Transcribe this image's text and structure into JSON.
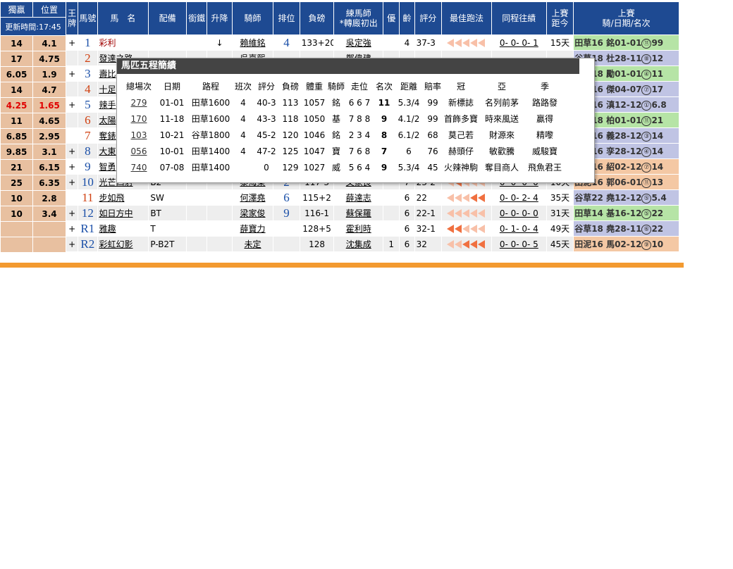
{
  "odds": {
    "win_label": "獨贏",
    "place_label": "位置",
    "update_label": "更新時間:17:45",
    "rows": [
      {
        "win": "14",
        "place": "4.1"
      },
      {
        "win": "17",
        "place": "4.75"
      },
      {
        "win": "6.05",
        "place": "1.9"
      },
      {
        "win": "14",
        "place": "4.7"
      },
      {
        "win": "4.25",
        "place": "1.65",
        "red": true
      },
      {
        "win": "11",
        "place": "4.65"
      },
      {
        "win": "6.85",
        "place": "2.95"
      },
      {
        "win": "9.85",
        "place": "3.1"
      },
      {
        "win": "21",
        "place": "6.15"
      },
      {
        "win": "25",
        "place": "6.35"
      },
      {
        "win": "10",
        "place": "2.8"
      },
      {
        "win": "10",
        "place": "3.4"
      },
      {
        "win": "",
        "place": ""
      },
      {
        "win": "",
        "place": ""
      }
    ]
  },
  "headers": [
    "王牌",
    "馬號",
    "馬　名",
    "配備",
    "銜鐵",
    "升降",
    "騎師",
    "排位",
    "負磅",
    "練馬師\n*轉廄初出",
    "優",
    "齡",
    "評分",
    "最佳跑法",
    "同程往績",
    "上賽\n距今",
    "上賽\n騎/日期/名次"
  ],
  "rows": [
    {
      "ace": "+",
      "no": "1",
      "name": "彩利",
      "gear": "",
      "bit": "",
      "change": "↓",
      "jockey": "賴維銘",
      "draw": "4",
      "wt": "133+20",
      "trainer": "吳定強",
      "pref": "",
      "age": "4",
      "rating": "37-3",
      "style": "hhhhh",
      "same": "0- 0- 0- 1",
      "days": "15天",
      "last": "田草16 銘01-01",
      "pos": "⑪",
      "tail": "99",
      "lc": "green"
    },
    {
      "ace": "",
      "no": "2",
      "name": "發達之路",
      "gear": "",
      "bit": "",
      "change": "",
      "jockey": "吳嘉熙",
      "draw": "",
      "wt": "",
      "trainer": "鄭偉建",
      "pref": "",
      "age": "",
      "rating": "",
      "style": "",
      "same": "",
      "days": "",
      "last": "谷草18 杜28-11",
      "pos": "⑧",
      "tail": "12",
      "lc": "blue"
    },
    {
      "ace": "+",
      "no": "3",
      "name": "壽比",
      "gear": "",
      "bit": "",
      "change": "",
      "jockey": "",
      "draw": "",
      "wt": "",
      "trainer": "",
      "pref": "",
      "age": "",
      "rating": "",
      "style": "",
      "same": "",
      "days": "",
      "last": "谷草18 勵01-01",
      "pos": "④",
      "tail": "11",
      "lc": "green"
    },
    {
      "ace": "",
      "no": "4",
      "name": "十足",
      "gear": "",
      "bit": "",
      "change": "",
      "jockey": "",
      "draw": "",
      "wt": "",
      "trainer": "",
      "pref": "",
      "age": "",
      "rating": "",
      "style": "",
      "same": "",
      "days": "",
      "last": "田草16 傑04-07",
      "pos": "⑦",
      "tail": "17",
      "lc": "blue"
    },
    {
      "ace": "+",
      "no": "5",
      "name": "辣手",
      "gear": "",
      "bit": "",
      "change": "",
      "jockey": "",
      "draw": "",
      "wt": "",
      "trainer": "",
      "pref": "",
      "age": "",
      "rating": "",
      "style": "",
      "same": "",
      "days": "",
      "last": "田草16 滇12-12",
      "pos": "①",
      "tail": "6.8",
      "lc": "blue"
    },
    {
      "ace": "",
      "no": "6",
      "name": "太陽",
      "gear": "",
      "bit": "",
      "change": "",
      "jockey": "",
      "draw": "",
      "wt": "",
      "trainer": "",
      "pref": "",
      "age": "",
      "rating": "",
      "style": "",
      "same": "",
      "days": "",
      "last": "谷草18 柏01-01",
      "pos": "⑪",
      "tail": "21",
      "lc": "green"
    },
    {
      "ace": "",
      "no": "7",
      "name": "奪錶",
      "gear": "",
      "bit": "",
      "change": "",
      "jockey": "",
      "draw": "",
      "wt": "",
      "trainer": "",
      "pref": "",
      "age": "",
      "rating": "",
      "style": "",
      "same": "",
      "days": "",
      "last": "田草16 義28-12",
      "pos": "③",
      "tail": "14",
      "lc": "blue"
    },
    {
      "ace": "+",
      "no": "8",
      "name": "大東",
      "gear": "",
      "bit": "",
      "change": "",
      "jockey": "",
      "draw": "",
      "wt": "",
      "trainer": "",
      "pref": "",
      "age": "",
      "rating": "",
      "style": "",
      "same": "",
      "days": "",
      "last": "田草16 孪28-12",
      "pos": "④",
      "tail": "14",
      "lc": "blue"
    },
    {
      "ace": "+",
      "no": "9",
      "name": "智勇",
      "gear": "",
      "bit": "",
      "change": "",
      "jockey": "",
      "draw": "",
      "wt": "",
      "trainer": "",
      "pref": "",
      "age": "",
      "rating": "",
      "style": "",
      "same": "",
      "days": "",
      "last": "田草16 紹02-12",
      "pos": "⑦",
      "tail": "14",
      "lc": "orange"
    },
    {
      "ace": "+",
      "no": "10",
      "name": "光芒四射",
      "gear": "B2",
      "bit": "",
      "change": "",
      "jockey": "黎海榮",
      "draw": "2",
      "wt": "117-3",
      "trainer": "文家良",
      "pref": "",
      "age": "7",
      "rating": "23-2",
      "style": "hfhhh",
      "same": "0- 0- 0- 0",
      "days": "10天",
      "last": "田泥16 郭06-01",
      "pos": "⑪",
      "tail": "13",
      "lc": "orange"
    },
    {
      "ace": "",
      "no": "11",
      "name": "步如飛",
      "gear": "SW",
      "bit": "",
      "change": "",
      "jockey": "何澤堯",
      "draw": "6",
      "wt": "115+2",
      "trainer": "薛達志",
      "pref": "",
      "age": "6",
      "rating": "22",
      "style": "hhhff",
      "same": "0- 0- 2- 4",
      "days": "35天",
      "last": "谷草22 堯12-12",
      "pos": "⑤",
      "tail": "5.4",
      "lc": "blue"
    },
    {
      "ace": "+",
      "no": "12",
      "name": "如日方中",
      "gear": "BT",
      "bit": "",
      "change": "",
      "jockey": "梁家俊",
      "draw": "9",
      "wt": "116-1",
      "trainer": "蘇保羅",
      "pref": "",
      "age": "6",
      "rating": "22-1",
      "style": "hhhhh",
      "same": "0- 0- 0- 0",
      "days": "31天",
      "last": "田草14 基16-12",
      "pos": "⑤",
      "tail": "22",
      "lc": "green"
    },
    {
      "ace": "+",
      "no": "R1",
      "name": "雅趣",
      "gear": "T",
      "bit": "",
      "change": "",
      "jockey": "薛寶力",
      "draw": "",
      "wt": "128+5",
      "trainer": "霍利時",
      "pref": "",
      "age": "6",
      "rating": "32-1",
      "style": "ffhhh",
      "same": "0- 1- 0- 4",
      "days": "49天",
      "last": "谷草18 堯28-11",
      "pos": "⑥",
      "tail": "22",
      "lc": "blue"
    },
    {
      "ace": "+",
      "no": "R2",
      "name": "彩虹幻影",
      "gear": "P-B2T",
      "bit": "",
      "change": "",
      "jockey": "未定",
      "draw": "",
      "wt": "128",
      "trainer": "沈集成",
      "pref": "1",
      "age": "6",
      "rating": "32",
      "style": "hhfff",
      "same": "0- 0- 0- 5",
      "days": "45天",
      "last": "田泥16 馬02-12",
      "pos": "⑨",
      "tail": "10",
      "lc": "orange"
    }
  ],
  "popup": {
    "title": "馬匹五程簡績",
    "headers": [
      "總場次",
      "日期",
      "路程",
      "班次",
      "評分",
      "負磅",
      "體重",
      "騎師",
      "走位",
      "名次",
      "距離",
      "賠率",
      "冠",
      "亞",
      "季"
    ],
    "rows": [
      {
        "race": "279",
        "date": "01-01",
        "course": "田草1600",
        "cls": "4",
        "rating": "40-3",
        "wt": "113",
        "bw": "1057",
        "jockey": "銘",
        "run": "6 6 7",
        "place": "11",
        "dist": "5.3/4",
        "odds": "99",
        "first": "新標誌",
        "second": "名列前茅",
        "third": "路路發"
      },
      {
        "race": "170",
        "date": "11-18",
        "course": "田草1600",
        "cls": "4",
        "rating": "43-3",
        "wt": "118",
        "bw": "1050",
        "jockey": "基",
        "run": "7 8 8",
        "place": "9",
        "dist": "4.1/2",
        "odds": "99",
        "first": "首飾多寶",
        "second": "時來風送",
        "third": "贏得"
      },
      {
        "race": "103",
        "date": "10-21",
        "course": "谷草1800",
        "cls": "4",
        "rating": "45-2",
        "wt": "120",
        "bw": "1046",
        "jockey": "銘",
        "run": "2 3 4",
        "place": "8",
        "dist": "6.1/2",
        "odds": "68",
        "first": "莫己若",
        "second": "財源來",
        "third": "精嚟"
      },
      {
        "race": "056",
        "date": "10-01",
        "course": "田草1400",
        "cls": "4",
        "rating": "47-2",
        "wt": "125",
        "bw": "1047",
        "jockey": "寶",
        "run": "7 6 8",
        "place": "7",
        "dist": "6",
        "odds": "76",
        "first": "赫頭仔",
        "second": "敏歡騰",
        "third": "威駿寶"
      },
      {
        "race": "740",
        "date": "07-08",
        "course": "田草1400",
        "cls": "",
        "rating": "0",
        "wt": "129",
        "bw": "1027",
        "jockey": "威",
        "run": "5 6 4",
        "place": "9",
        "dist": "5.3/4",
        "odds": "45",
        "first": "火辣神駒",
        "second": "奪目商人",
        "third": "飛魚君王"
      }
    ]
  },
  "colors": {
    "header": "#1e4a92",
    "odds_bg": "#e8c0a0",
    "orange_bar": "#f39a30"
  }
}
